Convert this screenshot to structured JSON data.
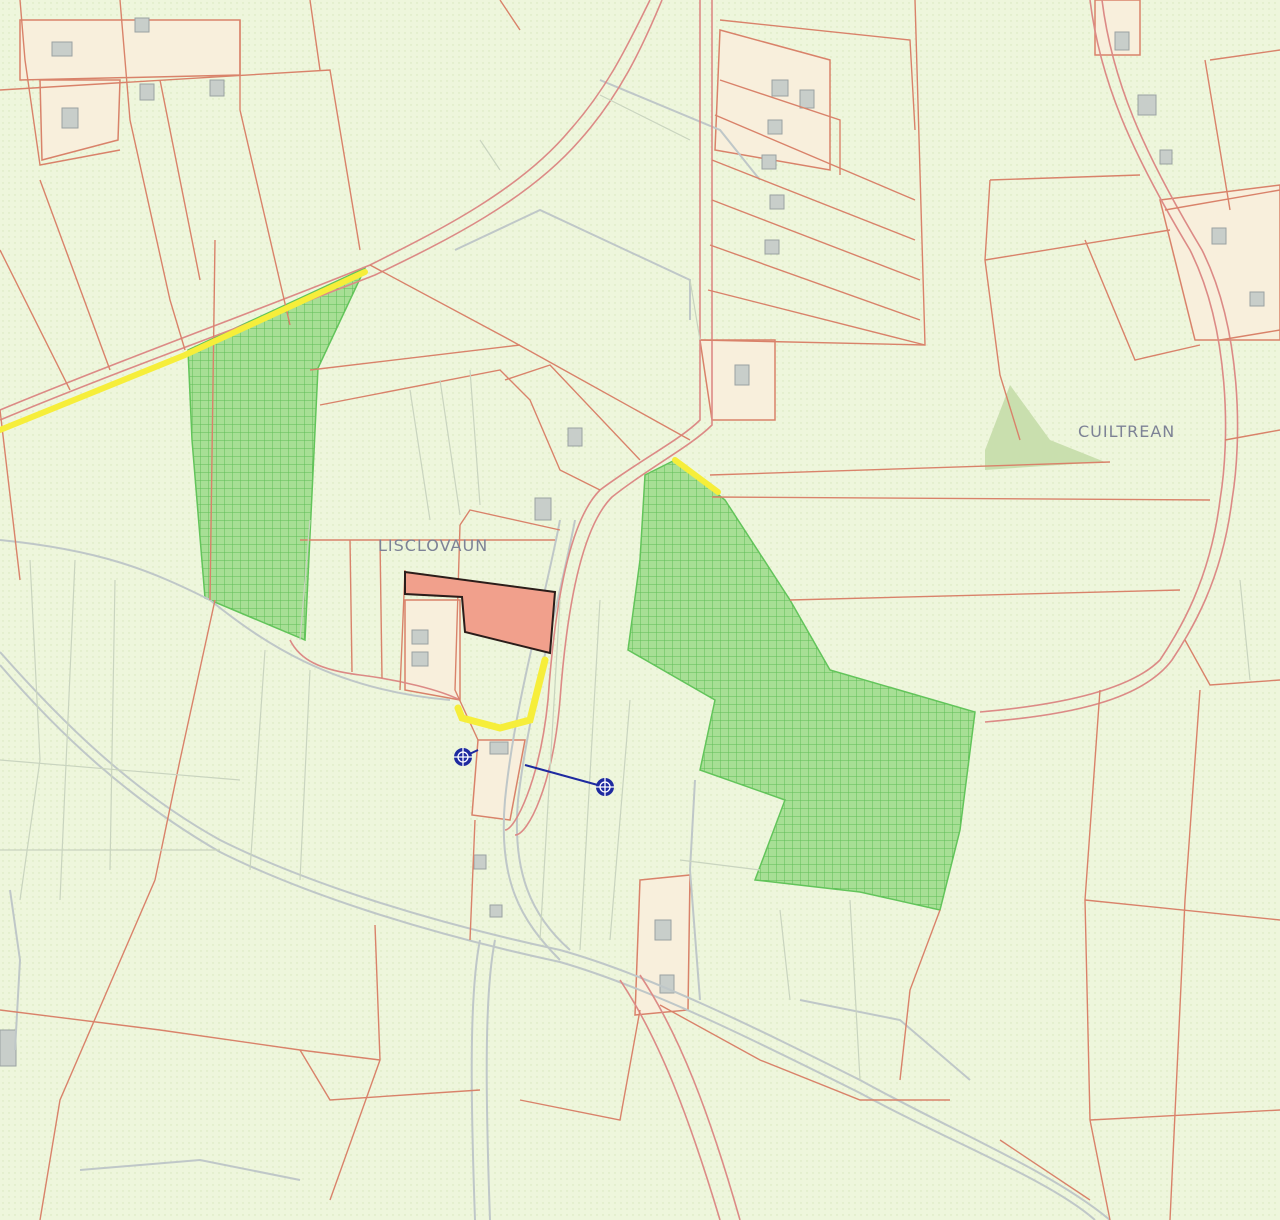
{
  "map": {
    "townlands": [
      {
        "name": "LISCLOVAUN"
      },
      {
        "name": "CUILTREAN"
      }
    ],
    "colors": {
      "background": "#eef6dc",
      "field_boundary": "#d9826a",
      "road": "#bfc7c8",
      "forestry": "#62c45a",
      "site_boundary": "#2b1d1a",
      "site_fill": "#f1a08c",
      "right_of_way": "#f6ee3a",
      "survey_marker": "#1e2aa0",
      "building": "#c8ceca"
    },
    "symbols": [
      "survey-marker-icon",
      "survey-marker-icon"
    ]
  }
}
